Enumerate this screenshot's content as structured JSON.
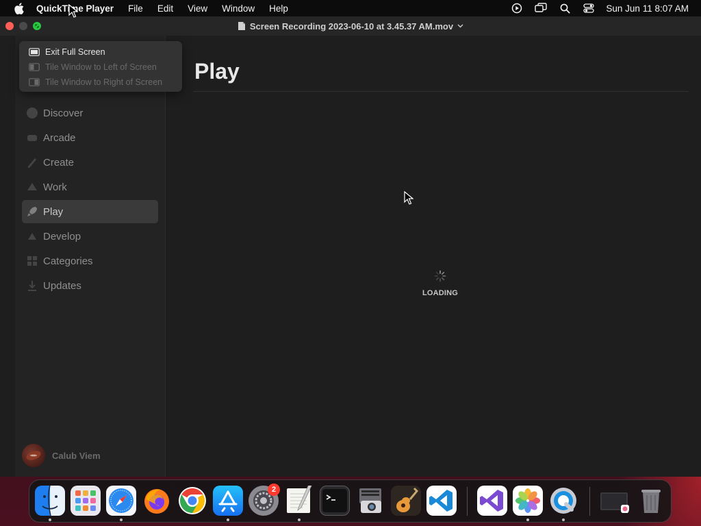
{
  "menubar": {
    "app_name": "QuickTime Player",
    "items": [
      "File",
      "Edit",
      "View",
      "Window",
      "Help"
    ],
    "clock": "Sun Jun 11  8:07 AM",
    "status_icons": [
      "screen-recording-icon",
      "screen-mirroring-icon",
      "spotlight-search-icon",
      "control-center-icon"
    ]
  },
  "window": {
    "title": "Screen Recording 2023-06-10 at 3.45.37 AM.mov",
    "fullscreen_menu": {
      "items": [
        {
          "label": "Exit Full Screen",
          "enabled": true
        },
        {
          "label": "Tile Window to Left of Screen",
          "enabled": false
        },
        {
          "label": "Tile Window to Right of Screen",
          "enabled": false
        }
      ]
    },
    "sidebar": {
      "items": [
        {
          "label": "Discover"
        },
        {
          "label": "Arcade"
        },
        {
          "label": "Create"
        },
        {
          "label": "Work"
        },
        {
          "label": "Play",
          "active": true
        },
        {
          "label": "Develop"
        },
        {
          "label": "Categories"
        },
        {
          "label": "Updates"
        }
      ],
      "user_name": "Calub Viem"
    },
    "main": {
      "title": "Play",
      "loading_text": "LOADING"
    }
  },
  "dock": {
    "apps": [
      {
        "name": "Finder",
        "icon": "finder-icon",
        "running": true
      },
      {
        "name": "Launchpad",
        "icon": "launchpad-icon",
        "running": false
      },
      {
        "name": "Safari",
        "icon": "safari-icon",
        "running": true
      },
      {
        "name": "Firefox",
        "icon": "firefox-icon",
        "running": false
      },
      {
        "name": "Chrome",
        "icon": "chrome-icon",
        "running": false
      },
      {
        "name": "App Store",
        "icon": "app-store-icon",
        "running": true
      },
      {
        "name": "System Settings",
        "icon": "system-settings-icon",
        "running": false,
        "badge": "2"
      },
      {
        "name": "TextEdit",
        "icon": "textedit-icon",
        "running": true
      },
      {
        "name": "Terminal",
        "icon": "terminal-icon",
        "running": false
      },
      {
        "name": "Screenshot",
        "icon": "screenshot-icon",
        "running": false
      },
      {
        "name": "GarageBand",
        "icon": "garageband-icon",
        "running": false
      },
      {
        "name": "Visual Studio Code",
        "icon": "vscode-icon",
        "running": false
      },
      {
        "name": "Visual Studio",
        "icon": "visual-studio-icon",
        "running": false
      },
      {
        "name": "Photos",
        "icon": "photos-icon",
        "running": true
      },
      {
        "name": "QuickTime Player",
        "icon": "quicktime-icon",
        "running": true
      },
      {
        "name": "Downloads",
        "icon": "downloads-stack-icon",
        "running": false
      },
      {
        "name": "Trash",
        "icon": "trash-icon",
        "running": false
      }
    ]
  }
}
